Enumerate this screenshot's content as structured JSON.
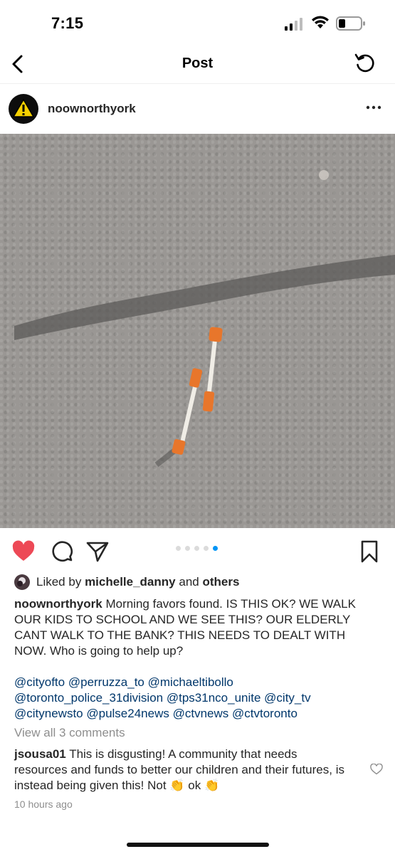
{
  "status_bar": {
    "time": "7:15"
  },
  "nav": {
    "title": "Post"
  },
  "post": {
    "username": "noownorthyork",
    "likes": {
      "prefix": "Liked by",
      "user": "michelle_danny",
      "conj": "and",
      "others": "others"
    },
    "caption": {
      "username": "noownorthyork",
      "text": "Morning favors found. IS THIS OK? WE WALK OUR KIDS TO SCHOOL AND WE SEE THIS? OUR ELDERLY CANT WALK TO THE BANK? THIS NEEDS TO DEALT WITH NOW. Who is going to help up?"
    },
    "mentions": [
      "@cityofto",
      "@perruzza_to",
      "@michaeltibollo",
      "@toronto_police_31division",
      "@tps31nco_unite",
      "@city_tv",
      "@citynewsto",
      "@pulse24news",
      "@ctvnews",
      "@ctvtoronto"
    ],
    "view_all_comments": "View all 3 comments",
    "comment": {
      "username": "jsousa01",
      "text_part1": "This is disgusting! A community that needs resources and funds to better our children and their futures, is instead being given this! Not",
      "emoji1": "👏",
      "text_part2": "ok",
      "emoji2": "👏"
    },
    "timestamp": "10 hours ago",
    "carousel": {
      "count": 5,
      "active_index": 4
    }
  },
  "colors": {
    "like_red": "#ed4956",
    "link_blue": "#00376b",
    "dot_active": "#0095f6",
    "muted": "#8e8e8e"
  },
  "icons": [
    "back-icon",
    "refresh-icon",
    "warning-icon",
    "more-icon",
    "heart-icon",
    "comment-icon",
    "share-icon",
    "bookmark-icon"
  ]
}
